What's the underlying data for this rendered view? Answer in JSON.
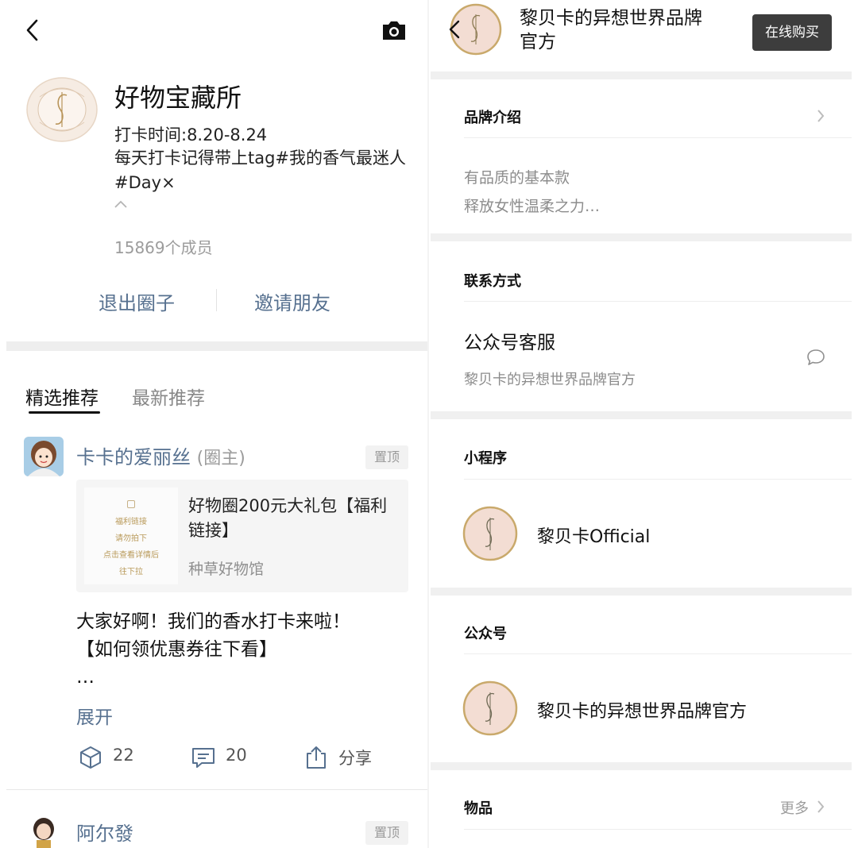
{
  "left": {
    "group": {
      "title": "好物宝藏所",
      "period": "打卡时间:8.20-8.24",
      "description": "每天打卡记得带上tag#我的香气最迷人#Day×",
      "members": "15869个成员"
    },
    "actions": {
      "leave": "退出圈子",
      "invite": "邀请朋友"
    },
    "tabs": [
      {
        "label": "精选推荐",
        "active": true
      },
      {
        "label": "最新推荐",
        "active": false
      }
    ],
    "post1": {
      "author": "卡卡的爱丽丝",
      "role": "(圈主)",
      "pinned": "置顶",
      "link_card": {
        "thumb_lines": [
          "福利链接",
          "请勿拍下",
          "点击查看详情后",
          "往下拉"
        ],
        "title": "好物圈200元大礼包【福利链接】",
        "source": "种草好物馆"
      },
      "body_line1": "大家好啊！我们的香水打卡来啦！",
      "body_line2": "【如何领优惠券往下看】",
      "body_line3": "…",
      "expand": "展开",
      "likes": "22",
      "comments": "20",
      "share": "分享"
    },
    "post2": {
      "author": "阿尔發",
      "pinned": "置顶"
    }
  },
  "right": {
    "header": {
      "title": "黎贝卡的异想世界品牌官方",
      "buy_button": "在线购买"
    },
    "brand_intro": {
      "label": "品牌介绍",
      "line1": "有品质的基本款",
      "line2": "释放女性温柔之力…"
    },
    "contact": {
      "label": "联系方式",
      "service_title": "公众号客服",
      "service_sub": "黎贝卡的异想世界品牌官方"
    },
    "mini_program": {
      "label": "小程序",
      "name": "黎贝卡Official"
    },
    "official_account": {
      "label": "公众号",
      "name": "黎贝卡的异想世界品牌官方"
    },
    "items": {
      "label": "物品",
      "more": "更多"
    }
  },
  "colors": {
    "link_blue": "#56708f",
    "logo_bg": "#f3ddd3",
    "logo_ring": "#c9a96b",
    "button_dark": "#3d3d3d"
  },
  "icons": [
    "back-arrow-icon",
    "camera-icon",
    "chevron-up-icon",
    "like-cube-icon",
    "comment-icon",
    "share-icon",
    "chevron-right-icon",
    "chat-bubble-icon"
  ]
}
